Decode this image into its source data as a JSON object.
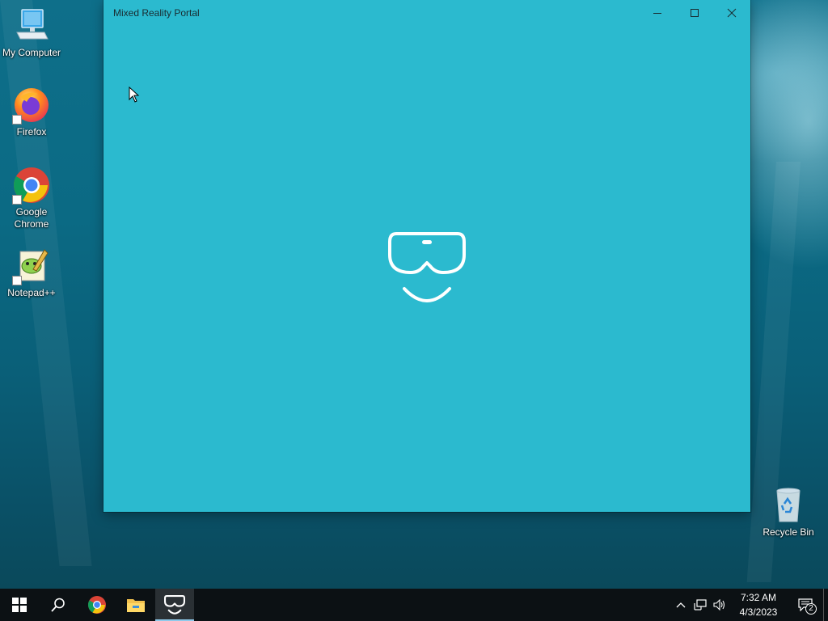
{
  "desktop": {
    "icons": [
      {
        "label": "My Computer",
        "icon": "computer-icon"
      },
      {
        "label": "Firefox",
        "icon": "firefox-icon"
      },
      {
        "label": "Google Chrome",
        "icon": "chrome-icon"
      },
      {
        "label": "Notepad++",
        "icon": "notepadpp-icon"
      },
      {
        "label": "Recycle Bin",
        "icon": "recycle-bin-icon"
      }
    ]
  },
  "window": {
    "title": "Mixed Reality Portal",
    "background": "#2bbacf",
    "logo": "mixed-reality-headset-icon",
    "controls": [
      "minimize",
      "maximize",
      "close"
    ]
  },
  "taskbar": {
    "items": [
      "start-icon",
      "search-icon",
      "chrome-icon",
      "file-explorer-icon",
      "mixed-reality-portal-icon"
    ],
    "active": "mixed-reality-portal-icon",
    "tray": {
      "icons": [
        "chevron-up-icon",
        "network-icon",
        "volume-icon"
      ],
      "time": "7:32 AM",
      "date": "4/3/2023",
      "notification_count": "2"
    }
  }
}
